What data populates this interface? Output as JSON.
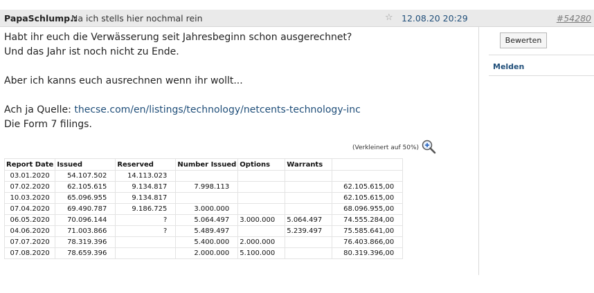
{
  "header": {
    "author": "PapaSchlump.:",
    "subject": "Na ich stells hier nochmal rein",
    "date": "12.08.20 20:29",
    "post_number": "#54280"
  },
  "post": {
    "line1": "Habt ihr euch die Verwässerung seit Jahresbeginn schon ausgerechnet?",
    "line2": "Und das Jahr ist noch nicht zu Ende.",
    "line3": "Aber ich kanns euch ausrechnen wenn ihr wollt...",
    "source_prefix": "Ach ja Quelle: ",
    "source_link": "thecse.com/en/listings/technology/netcents-technology-inc",
    "line5": "Die Form 7 filings."
  },
  "image": {
    "zoom_label": "(Verkleinert auf 50%)"
  },
  "sidebar": {
    "rate_button": "Bewerten",
    "report_link": "Melden"
  },
  "table": {
    "headers": [
      "Report Date",
      "Issued",
      "Reserved",
      "Number Issued",
      "Options",
      "Warrants",
      ""
    ],
    "rows": [
      [
        "03.01.2020",
        "54.107.502",
        "14.113.023",
        "",
        "",
        "",
        ""
      ],
      [
        "07.02.2020",
        "62.105.615",
        "9.134.817",
        "7.998.113",
        "",
        "",
        "62.105.615,00"
      ],
      [
        "10.03.2020",
        "65.096.955",
        "9.134.817",
        "",
        "",
        "",
        "62.105.615,00"
      ],
      [
        "07.04.2020",
        "69.490.787",
        "9.186.725",
        "3.000.000",
        "",
        "",
        "68.096.955,00"
      ],
      [
        "06.05.2020",
        "70.096.144",
        "?",
        "5.064.497",
        "3.000.000",
        "5.064.497",
        "74.555.284,00"
      ],
      [
        "04.06.2020",
        "71.003.866",
        "?",
        "5.489.497",
        "",
        "5.239.497",
        "75.585.641,00"
      ],
      [
        "07.07.2020",
        "78.319.396",
        "",
        "5.400.000",
        "2.000.000",
        "",
        "76.403.866,00"
      ],
      [
        "07.08.2020",
        "78.659.396",
        "",
        "2.000.000",
        "5.100.000",
        "",
        "80.319.396,00"
      ]
    ]
  }
}
